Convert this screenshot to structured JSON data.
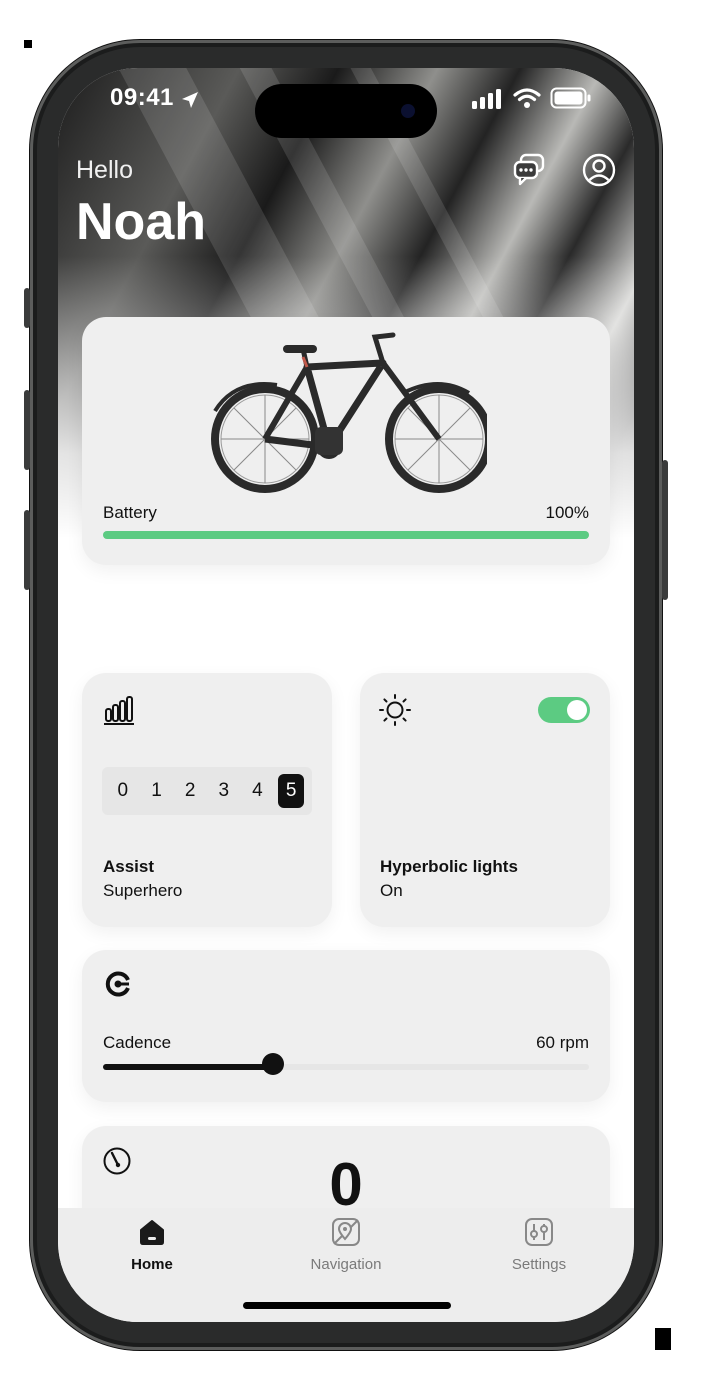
{
  "status_bar": {
    "time": "09:41"
  },
  "header": {
    "greeting": "Hello",
    "user_name": "Noah"
  },
  "battery_card": {
    "label": "Battery",
    "value_text": "100%",
    "level": 1.0
  },
  "assist_card": {
    "levels": [
      "0",
      "1",
      "2",
      "3",
      "4",
      "5"
    ],
    "selected_index": 5,
    "title": "Assist",
    "value": "Superhero",
    "icon": "bar-chart-icon"
  },
  "lights_card": {
    "title": "Hyperbolic lights",
    "value": "On",
    "toggle_on": true,
    "icon": "sun-icon"
  },
  "cadence_card": {
    "label": "Cadence",
    "value_text": "60 rpm",
    "level": 0.35,
    "icon": "cadence-icon"
  },
  "speed_card": {
    "value": "0",
    "icon": "speedometer-icon"
  },
  "tab_bar": {
    "tabs": [
      {
        "label": "Home",
        "icon": "house-icon",
        "active": true
      },
      {
        "label": "Navigation",
        "icon": "map-icon",
        "active": false
      },
      {
        "label": "Settings",
        "icon": "sliders-icon",
        "active": false
      }
    ]
  },
  "colors": {
    "accent_green": "#5ccb82",
    "card_bg": "#efefef",
    "text": "#111111"
  }
}
